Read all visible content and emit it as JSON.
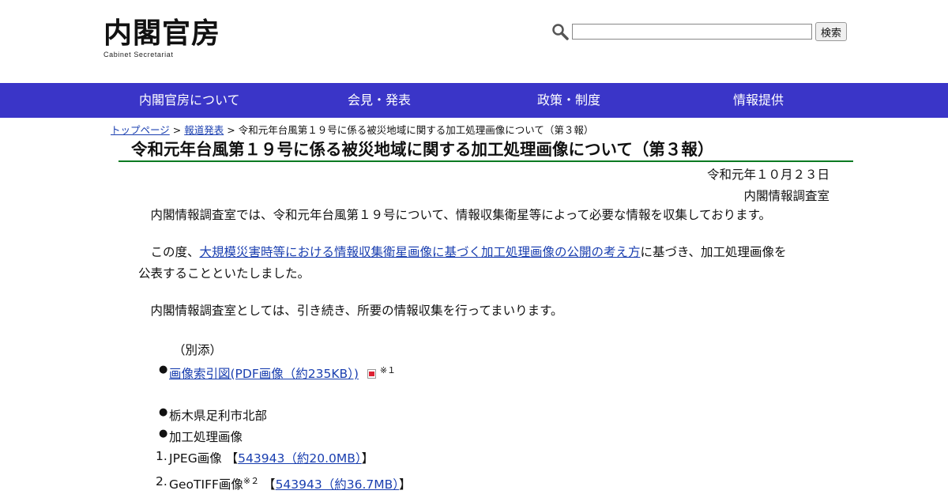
{
  "header": {
    "logo_main": "内閣官房",
    "logo_sub": "Cabinet Secretariat",
    "search_button": "検索",
    "search_value": ""
  },
  "gnav": [
    "内閣官房について",
    "会見・発表",
    "政策・制度",
    "情報提供"
  ],
  "breadcrumb": {
    "top": "トップページ",
    "sep": ">",
    "press": "報道発表",
    "current": "令和元年台風第１９号に係る被災地域に関する加工処理画像について（第３報）"
  },
  "title": "令和元年台風第１９号に係る被災地域に関する加工処理画像について（第３報）",
  "date": "令和元年１０月２３日",
  "org": "内閣情報調査室",
  "body": {
    "p1": "　内閣情報調査室では、令和元年台風第１９号について、情報収集衛星等によって必要な情報を収集しております。",
    "p2_pre": "　この度、",
    "p2_link": "大規模災害時等における情報収集衛星画像に基づく加工処理画像の公開の考え方",
    "p2_post": "に基づき、加工処理画像を",
    "p2_line2": "公表することといたしました。",
    "p3": "　内閣情報調査室としては、引き続き、所要の情報収集を行ってまいります。"
  },
  "attachment_label": "（別添）",
  "attachments": {
    "index_link": "画像索引図(PDF画像（約235KB）)",
    "index_note": "※１",
    "area": "栃木県足利市北部",
    "processed": "加工処理画像",
    "items": [
      {
        "num": "1.",
        "label": "JPEG画像 ",
        "note": "",
        "link": "543943（約20.0MB）"
      },
      {
        "num": "2.",
        "label": "GeoTIFF画像",
        "note": "※２",
        "link": "543943（約36.7MB）"
      }
    ]
  },
  "colors": {
    "nav_bg": "#3a35c8",
    "link": "#1a3fb0",
    "title_rule": "#0a7a22"
  }
}
